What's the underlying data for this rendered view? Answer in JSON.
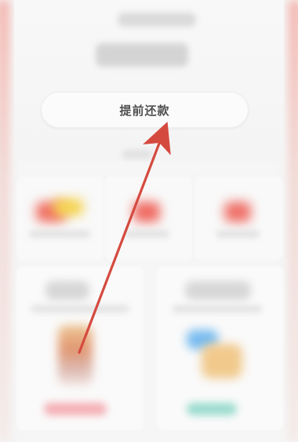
{
  "main": {
    "repay_button_label": "提前还款"
  },
  "colors": {
    "arrow": "#d54a3f",
    "button_text": "#4f4f4f"
  },
  "icons": {
    "annotation": "arrow-pointer-icon"
  }
}
